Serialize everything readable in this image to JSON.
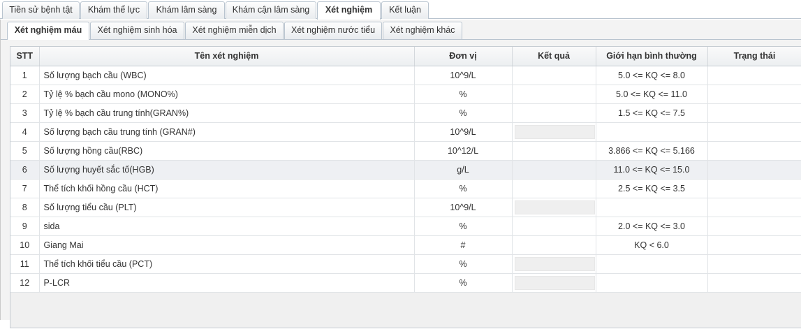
{
  "main_tabs": [
    {
      "label": "Tiền sử bệnh tật"
    },
    {
      "label": "Khám thể lực"
    },
    {
      "label": "Khám lâm sàng"
    },
    {
      "label": "Khám cận lâm sàng"
    },
    {
      "label": "Xét nghiệm"
    },
    {
      "label": "Kết luận"
    }
  ],
  "active_main_tab": "Xét nghiệm",
  "sub_tabs": [
    {
      "label": "Xét nghiệm máu"
    },
    {
      "label": "Xét nghiệm sinh hóa"
    },
    {
      "label": "Xét nghiệm miễn dịch"
    },
    {
      "label": "Xét nghiệm nước tiểu"
    },
    {
      "label": "Xét nghiệm khác"
    }
  ],
  "active_sub_tab": "Xét nghiệm máu",
  "table": {
    "columns": [
      "STT",
      "Tên xét nghiệm",
      "Đơn vị",
      "Kết quả",
      "Giới hạn bình thường",
      "Trạng thái"
    ],
    "rows": [
      {
        "stt": "1",
        "name": "Số lượng bạch cầu (WBC)",
        "unit": "10^9/L",
        "result": "",
        "range": "5.0 <= KQ <= 8.0",
        "status": ""
      },
      {
        "stt": "2",
        "name": "Tỷ lệ % bạch cầu mono (MONO%)",
        "unit": "%",
        "result": "",
        "range": "5.0 <= KQ <= 11.0",
        "status": ""
      },
      {
        "stt": "3",
        "name": "Tỷ lệ % bạch cầu trung tính(GRAN%)",
        "unit": "%",
        "result": "",
        "range": "1.5 <= KQ <= 7.5",
        "status": ""
      },
      {
        "stt": "4",
        "name": "Số lượng bạch cầu trung tính (GRAN#)",
        "unit": "10^9/L",
        "result": "",
        "range": "",
        "status": ""
      },
      {
        "stt": "5",
        "name": "Số lượng hồng cầu(RBC)",
        "unit": "10^12/L",
        "result": "",
        "range": "3.866 <= KQ <= 5.166",
        "status": ""
      },
      {
        "stt": "6",
        "name": "Số lượng huyết sắc tố(HGB)",
        "unit": "g/L",
        "result": "",
        "range": "11.0 <= KQ <= 15.0",
        "status": ""
      },
      {
        "stt": "7",
        "name": "Thể tích khối hồng cầu (HCT)",
        "unit": "%",
        "result": "",
        "range": "2.5 <= KQ <= 3.5",
        "status": ""
      },
      {
        "stt": "8",
        "name": "Số lượng tiểu cầu (PLT)",
        "unit": "10^9/L",
        "result": "",
        "range": "",
        "status": ""
      },
      {
        "stt": "9",
        "name": "sida",
        "unit": "%",
        "result": "",
        "range": "2.0 <= KQ <= 3.0",
        "status": ""
      },
      {
        "stt": "10",
        "name": "Giang Mai",
        "unit": "#",
        "result": "",
        "range": "KQ < 6.0",
        "status": ""
      },
      {
        "stt": "11",
        "name": "Thể tích khối tiểu cầu (PCT)",
        "unit": "%",
        "result": "",
        "range": "",
        "status": ""
      },
      {
        "stt": "12",
        "name": "P-LCR",
        "unit": "%",
        "result": "",
        "range": "",
        "status": ""
      }
    ]
  },
  "colors": {
    "highlight_row": "#eef0f3",
    "disabled_input": "#efefef",
    "border": "#b9c4cf"
  }
}
